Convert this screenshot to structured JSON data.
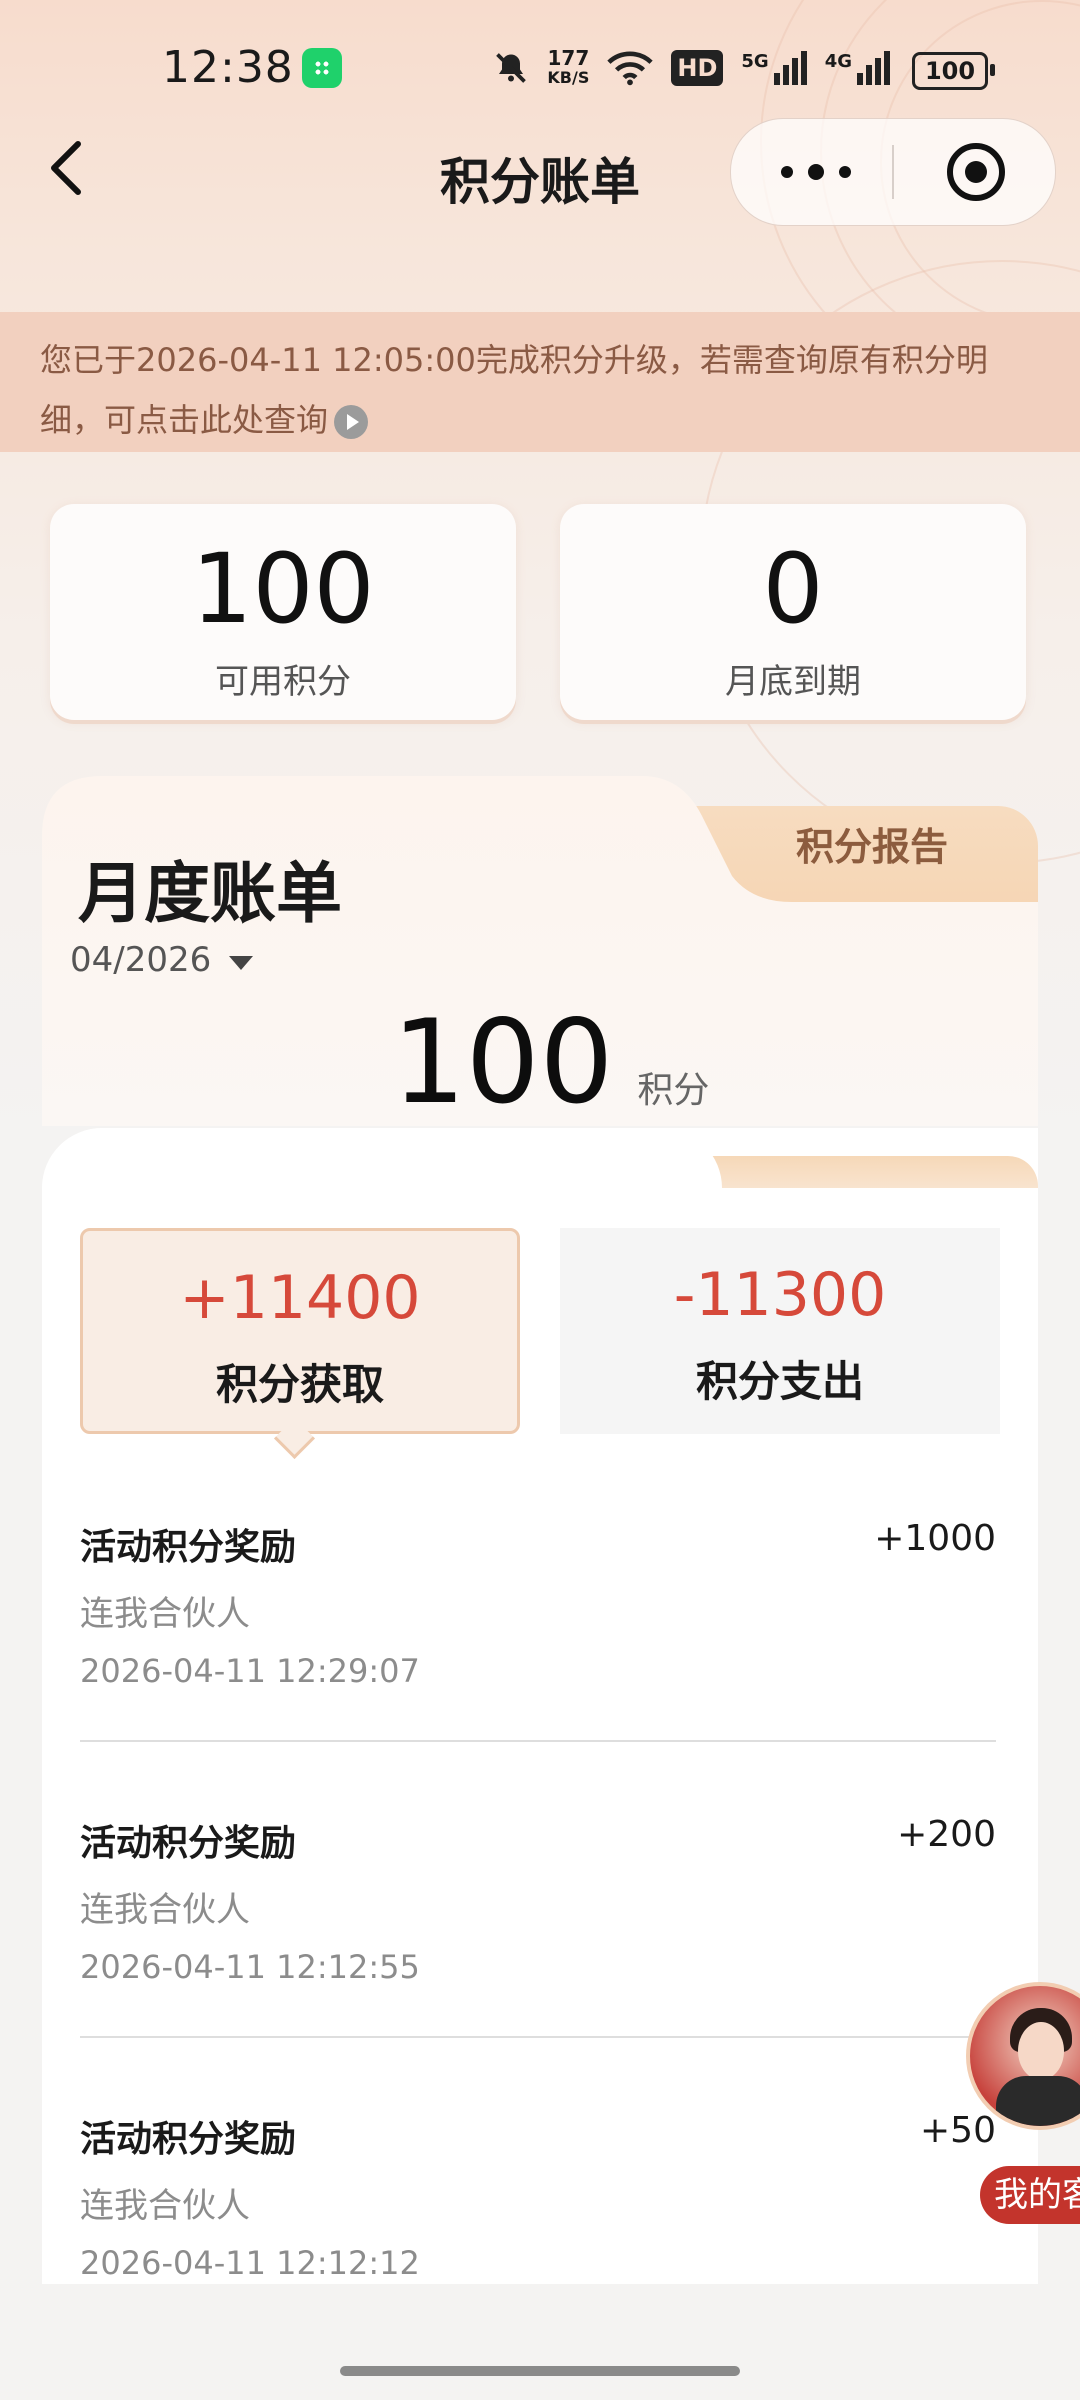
{
  "status_bar": {
    "time": "12:38",
    "net_speed_value": "177",
    "net_speed_unit": "KB/S",
    "hd_label": "HD",
    "net_5g": "5G",
    "net_4g": "4G",
    "battery": "100"
  },
  "nav": {
    "title": "积分账单"
  },
  "notice": {
    "text": "您已于2026-04-11 12:05:00完成积分升级，若需查询原有积分明细，可点击此处查询"
  },
  "summary": {
    "available_value": "100",
    "available_label": "可用积分",
    "expiring_value": "0",
    "expiring_label": "月底到期"
  },
  "monthly_bill": {
    "title": "月度账单",
    "report_tab": "积分报告",
    "month": "04/2026",
    "total": "100",
    "unit": "积分"
  },
  "toggles": {
    "earn_value": "+11400",
    "earn_label": "积分获取",
    "spend_value": "-11300",
    "spend_label": "积分支出"
  },
  "transactions": [
    {
      "title": "活动积分奖励",
      "amount": "+1000",
      "source": "连我合伙人",
      "time": "2026-04-11 12:29:07"
    },
    {
      "title": "活动积分奖励",
      "amount": "+200",
      "source": "连我合伙人",
      "time": "2026-04-11 12:12:55"
    },
    {
      "title": "活动积分奖励",
      "amount": "+50",
      "source": "连我合伙人",
      "time": "2026-04-11 12:12:12"
    }
  ],
  "assistant": {
    "label": "我的客"
  },
  "colors": {
    "accent_red": "#d6493a",
    "notice_bg": "#f2d0bf",
    "report_tab": "#f3c89c"
  }
}
